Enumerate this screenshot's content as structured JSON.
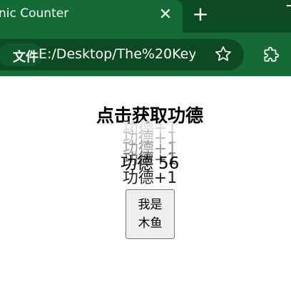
{
  "browser": {
    "tab_title": "nic Counter",
    "tab_close": "✕",
    "new_tab": "+",
    "scheme_label": "文件",
    "url": "E:/Desktop/The%20Key...",
    "colors": {
      "tabstrip": "#0c4a24",
      "toolbar": "#146b33"
    }
  },
  "page": {
    "title": "点击获取功德",
    "floating_texts": [
      "功德+1",
      "功德+1",
      "功德+1",
      "功德+1",
      "功德+1"
    ],
    "counter": "功德 56",
    "button_label": "我是\n木鱼"
  }
}
